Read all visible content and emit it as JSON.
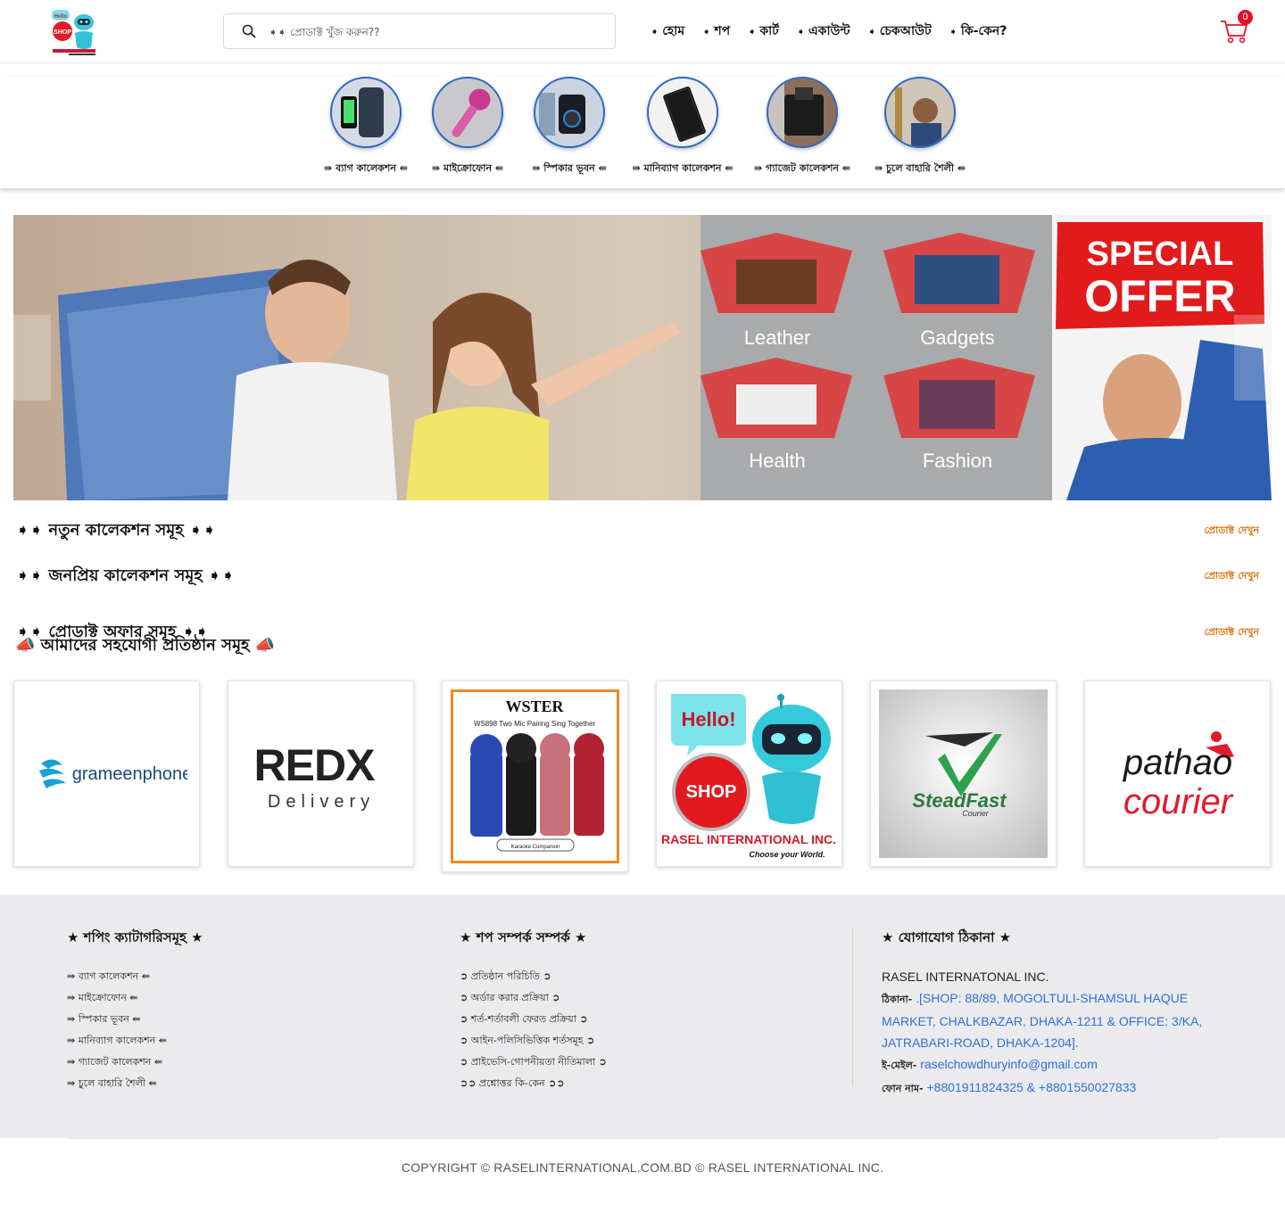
{
  "header": {
    "search_placeholder": "➧➧ প্রোডাক্ট খুঁজ করুন??",
    "nav": [
      {
        "label": "হোম"
      },
      {
        "label": "শপ"
      },
      {
        "label": "কার্ট"
      },
      {
        "label": "একাউন্ট"
      },
      {
        "label": "চেকআউট"
      },
      {
        "label": "কি-কেন?"
      }
    ],
    "cart_count": "0"
  },
  "categories": [
    {
      "label": "⇛ ব্যাগ কালেকশন ⇚"
    },
    {
      "label": "⇛ মাইক্রোফোন ⇚"
    },
    {
      "label": "⇛ স্পিকার ভূবন ⇚"
    },
    {
      "label": "⇛ মানিব্যাগ কালেকশন ⇚"
    },
    {
      "label": "⇛ গ্যাজেট কালেকশন ⇚"
    },
    {
      "label": "⇛ চুলে বাহারি শৈলী ⇚"
    }
  ],
  "sections": [
    {
      "title": "➧➧ নতুন কালেকশন সমূহ ➧➧",
      "link": "প্রোডাক্ট দেখুন"
    },
    {
      "title": "➧➧ জনপ্রিয় কালেকশন সমূহ ➧➧",
      "link": "প্রোডাক্ট দেখুন"
    },
    {
      "title": "➧➧ প্রোডাক্ট অফার সমূহ ➧➧",
      "link": "প্রোডাক্ট দেখুন"
    }
  ],
  "brands": {
    "title": "📣 আমাদের সহযোগী প্রতিষ্ঠান সমূহ 📣",
    "items": [
      {
        "name": "grameenphone"
      },
      {
        "name": "REDX",
        "sub": "Delivery"
      },
      {
        "name": "WSTER",
        "sub": "WS898 Two Mic Pairing Sing Together",
        "caption": "Karaoke Companion"
      },
      {
        "name": "RASEL INTERNATIONAL INC.",
        "sub": "Choose your World.",
        "hello": "Hello!",
        "shop": "SHOP"
      },
      {
        "name": "SteadFast",
        "sub": "Courier"
      },
      {
        "name": "pathao",
        "sub": "courier"
      }
    ]
  },
  "banner": {
    "tiles": [
      "Leather",
      "Gadgets",
      "Health",
      "Fashion"
    ],
    "special1": "SPECIAL",
    "special2": "OFFER"
  },
  "footer": {
    "col1": {
      "title": "★ শপিং ক্যাটাগরিসমূহ ★",
      "items": [
        "⇛ ব্যাগ কালেকশন ⇚",
        "⇛ মাইক্রোফোন ⇚",
        "⇛ স্পিকার ভূবন ⇚",
        "⇛ মানিব্যাগ কালেকশন ⇚",
        "⇛ গ্যাজেট কালেকশন ⇚",
        "⇛ চুলে বাহারি শৈলী ⇚"
      ]
    },
    "col2": {
      "title": "★ শপ সম্পর্ক সম্পর্ক ★",
      "items": [
        "➲ প্রতিষ্ঠান পরিচিতি ➲",
        "➲ অর্ডার করার প্রক্রিয়া ➲",
        "➲ শর্ত-শর্তাবলী ফেরত প্রক্রিয়া ➲",
        "➲ আইন-পলিসিভিত্তিক শর্তসমূহ ➲",
        "➲ প্রাইভেসি-গোপনীয়তা নীতিমালা ➲",
        "➲➲ প্রশ্নোত্তর কি-কেন ➲➲"
      ]
    },
    "col3": {
      "title": "★ যোগাযোগ ঠিকানা ★",
      "company": "RASEL INTERNATONAL INC.",
      "address_label": "ঠিকানা-",
      "address": " .[SHOP: 88/89, MOGOLTULI-SHAMSUL HAQUE MARKET, CHALKBAZAR, DHAKA-1211 & OFFICE: 3/KA, JATRABARI-ROAD, DHAKA-1204].",
      "email_label": "ই-মেইল-",
      "email": " raselchowdhuryinfo@gmail.com",
      "phone_label": "ফোন নাম-",
      "phone": " +8801911824325 & +8801550027833"
    },
    "copyright": "COPYRIGHT © RASELINTERNATIONAL.COM.BD © RASEL INTERNATIONAL INC."
  }
}
